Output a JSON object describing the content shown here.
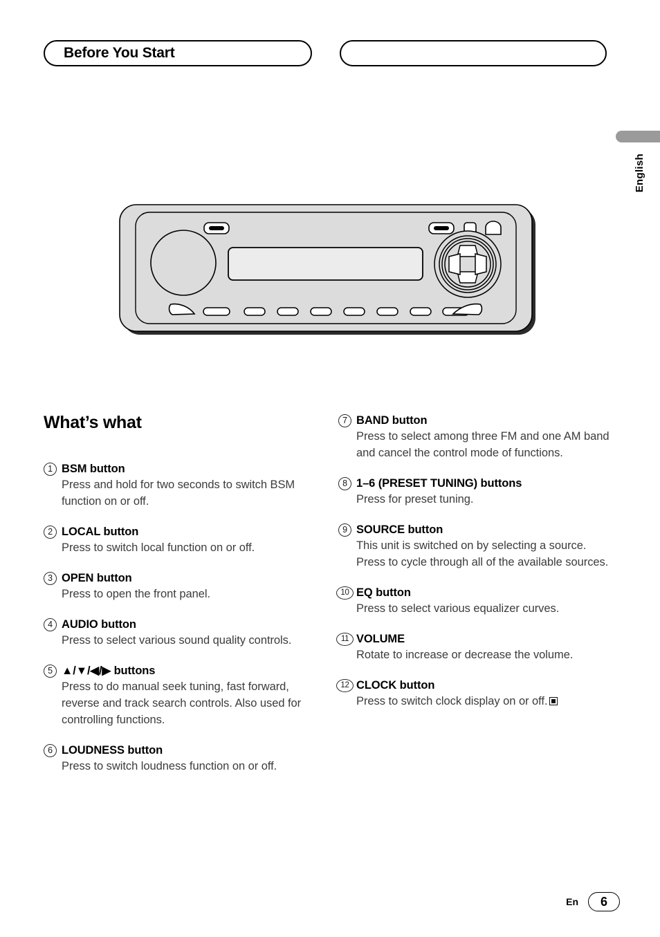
{
  "header": {
    "left_title": "Before You Start",
    "right_title": ""
  },
  "side_tab": {
    "language": "English"
  },
  "figure": {
    "name": "car-stereo-head-unit-illustration",
    "display_text": ""
  },
  "main": {
    "section_title": "What’s what",
    "left_items": [
      {
        "num": "①",
        "head": "BSM button",
        "desc": "Press and hold for two seconds to switch BSM function on or off."
      },
      {
        "num": "②",
        "head": "LOCAL button",
        "desc": "Press to switch local function on or off."
      },
      {
        "num": "③",
        "head": "OPEN button",
        "desc": "Press to open the front panel."
      },
      {
        "num": "④",
        "head": "AUDIO button",
        "desc": "Press to select various sound quality controls."
      },
      {
        "num": "⑤",
        "head": "▲/▼/◀/▶ buttons",
        "desc": "Press to do manual seek tuning, fast forward, reverse and track search controls. Also used for controlling functions."
      },
      {
        "num": "⑥",
        "head": "LOUDNESS button",
        "desc": "Press to switch loudness function on or off."
      }
    ],
    "right_items": [
      {
        "num": "⑦",
        "head": "BAND button",
        "desc": "Press to select among three FM and one AM band and cancel the control mode of functions."
      },
      {
        "num": "⑧",
        "head": "1–6 (PRESET TUNING) buttons",
        "desc": "Press for preset tuning."
      },
      {
        "num": "⑨",
        "head": "SOURCE button",
        "desc": "This unit is switched on by selecting a source. Press to cycle through all of the available sources."
      },
      {
        "num": "⑩",
        "head": "EQ button",
        "desc": "Press to select various equalizer curves."
      },
      {
        "num": "⑪",
        "head": "VOLUME",
        "desc": "Rotate to increase or decrease the volume."
      },
      {
        "num": "⑫",
        "head": "CLOCK button",
        "desc": "Press to switch clock display on or off.",
        "end_marker": true
      }
    ]
  },
  "footer": {
    "language": "En",
    "page_number": "6"
  },
  "colors": {
    "tab_gray": "#9a9a9a",
    "faceplate_gray": "#dcdcdc",
    "display_gray": "#ececec",
    "line_black": "#000000"
  }
}
